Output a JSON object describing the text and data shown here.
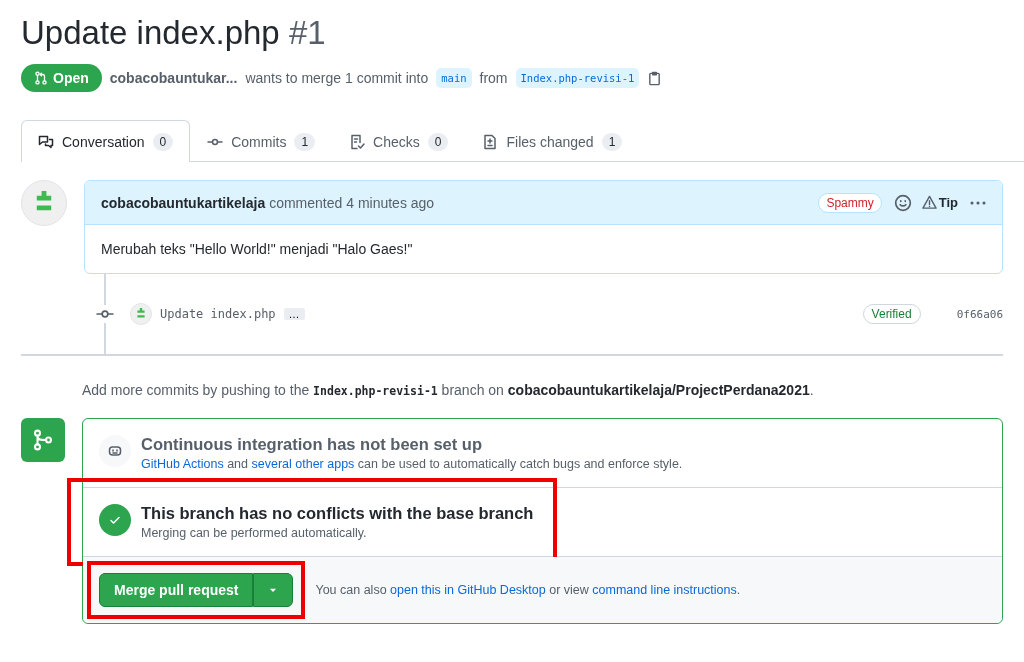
{
  "title": {
    "text": "Update index.php",
    "number": "#1"
  },
  "state_badge": {
    "label": "Open"
  },
  "summary": {
    "author": "cobacobauntukar...",
    "text": "wants to merge 1 commit into",
    "base": "main",
    "from": "from",
    "head": "Index.php-revisi-1"
  },
  "tabs": [
    {
      "label": "Conversation",
      "count": "0",
      "selected": true
    },
    {
      "label": "Commits",
      "count": "1",
      "selected": false
    },
    {
      "label": "Checks",
      "count": "0",
      "selected": false
    },
    {
      "label": "Files changed",
      "count": "1",
      "selected": false
    }
  ],
  "comment": {
    "author": "cobacobauntukartikelaja",
    "action": "commented 4 minutes ago",
    "label": "Spammy",
    "tip": "Tip",
    "body": "Merubah teks \"Hello World!\" menjadi \"Halo Gaes!\""
  },
  "commit": {
    "message": "Update index.php",
    "more": "…",
    "verified": "Verified",
    "sha": "0f66a06"
  },
  "push_hint": [
    {
      "kind": "plain",
      "text": "Add more commits by pushing to the "
    },
    {
      "kind": "code",
      "text": "Index.php-revisi-1"
    },
    {
      "kind": "plain",
      "text": " branch on "
    },
    {
      "kind": "bold",
      "text": "cobacobauntukartikelaja/ProjectPerdana2021"
    },
    {
      "kind": "plain",
      "text": "."
    }
  ],
  "merge_box": {
    "sections": [
      {
        "kind": "ci",
        "title": "Continuous integration has not been set up",
        "highlighted": false,
        "description": [
          {
            "kind": "link",
            "text": "GitHub Actions"
          },
          {
            "kind": "plain",
            "text": " and "
          },
          {
            "kind": "link",
            "text": "several other apps"
          },
          {
            "kind": "plain",
            "text": " can be used to automatically catch bugs and enforce style."
          }
        ]
      },
      {
        "kind": "ok",
        "title": "This branch has no conflicts with the base branch",
        "highlighted": true,
        "description": [
          {
            "kind": "plain",
            "text": "Merging can be performed automatically."
          }
        ]
      }
    ],
    "merge_button": {
      "label": "Merge pull request",
      "highlighted": true
    },
    "alt_text": [
      {
        "kind": "plain",
        "text": "You can also "
      },
      {
        "kind": "link",
        "text": "open this in GitHub Desktop"
      },
      {
        "kind": "plain",
        "text": " or view "
      },
      {
        "kind": "link",
        "text": "command line instructions"
      },
      {
        "kind": "plain",
        "text": "."
      }
    ]
  }
}
